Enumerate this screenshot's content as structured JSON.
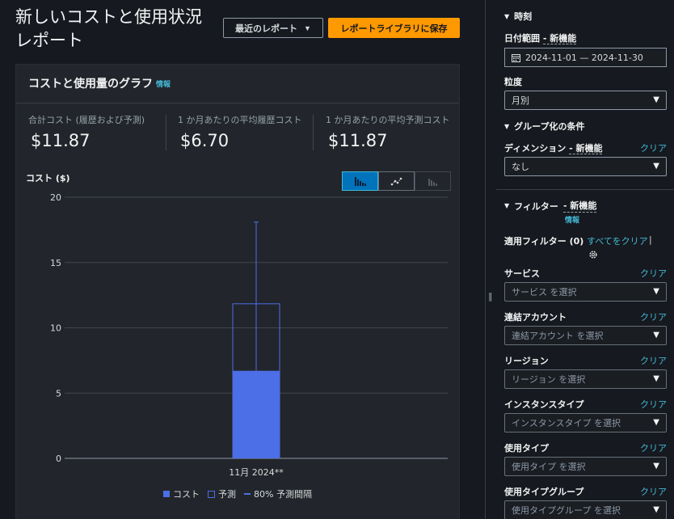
{
  "header": {
    "title": "新しいコストと使用状況レポート",
    "recent_reports_label": "最近のレポート",
    "save_to_library_label": "レポートライブラリに保存"
  },
  "card": {
    "title": "コストと使用量のグラフ",
    "info_label": "情報",
    "metrics": [
      {
        "label": "合計コスト (履歴および予測)",
        "value": "$11.87"
      },
      {
        "label": "1 か月あたりの平均履歴コスト",
        "value": "$6.70"
      },
      {
        "label": "1 か月あたりの平均予測コスト",
        "value": "$11.87"
      }
    ],
    "chart_title": "コスト ($)",
    "chart_type_selected": "bar",
    "legend": {
      "cost": "コスト",
      "forecast": "予測",
      "interval": "80% 予測間隔"
    }
  },
  "chart_data": {
    "type": "bar",
    "categories": [
      "11月 2024**"
    ],
    "series": [
      {
        "name": "コスト",
        "values": [
          6.7
        ]
      },
      {
        "name": "予測",
        "values": [
          11.87
        ]
      }
    ],
    "forecast_interval_80": {
      "low": 6.7,
      "high": 18.1
    },
    "ylabel": "コスト ($)",
    "ylim": [
      0,
      20
    ],
    "yticks": [
      0,
      5,
      10,
      15,
      20
    ],
    "grid": true,
    "colors": {
      "cost": "#4c6ee6",
      "forecast_outline": "#4c6ee6"
    }
  },
  "panel": {
    "time_section": "時刻",
    "date_range_label": "日付範囲",
    "new_feature": "新機能",
    "date_range_value": "2024-11-01 — 2024-11-30",
    "granularity_label": "粒度",
    "granularity_value": "月別",
    "group_section": "グループ化の条件",
    "dimension_label": "ディメンション",
    "dimension_value": "なし",
    "clear_label": "クリア",
    "filter_section": "フィルター",
    "info_label": "情報",
    "applied_filters": "適用フィルター (0)",
    "clear_all": "すべてをクリア",
    "filters": [
      {
        "label": "サービス",
        "placeholder": "サービス を選択"
      },
      {
        "label": "連結アカウント",
        "placeholder": "連結アカウント を選択"
      },
      {
        "label": "リージョン",
        "placeholder": "リージョン を選択"
      },
      {
        "label": "インスタンスタイプ",
        "placeholder": "インスタンスタイプ を選択"
      },
      {
        "label": "使用タイプ",
        "placeholder": "使用タイプ を選択"
      },
      {
        "label": "使用タイプグループ",
        "placeholder": "使用タイプグループ を選択"
      }
    ]
  },
  "icons": [
    "calendar-icon",
    "gear-icon",
    "bar-chart-icon",
    "line-chart-icon",
    "stacked-bar-icon",
    "caret-down-icon",
    "splitter-handle-icon"
  ]
}
